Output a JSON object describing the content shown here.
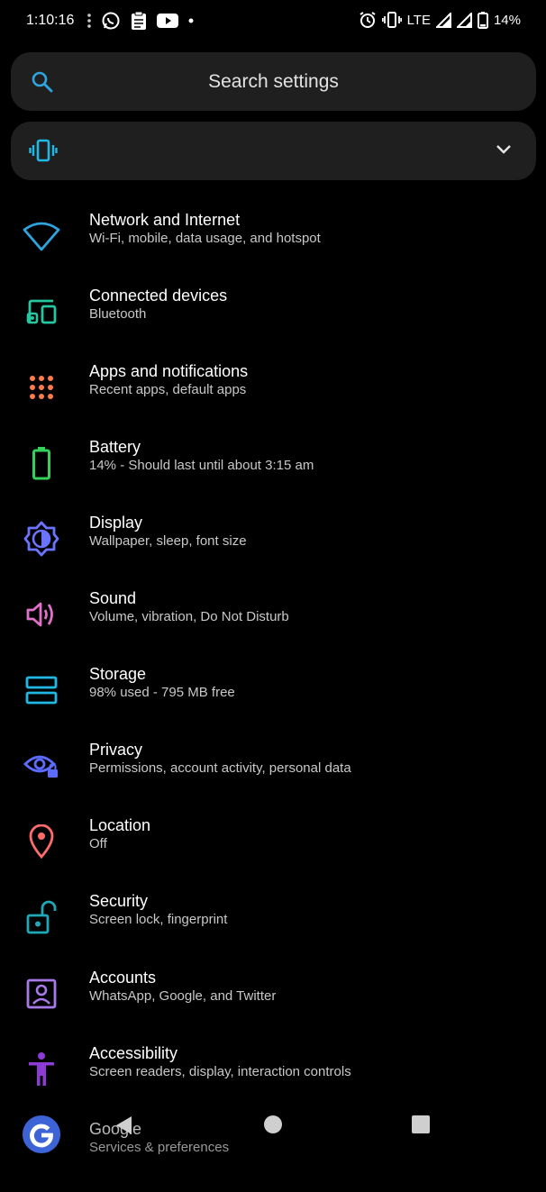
{
  "status_bar": {
    "time": "1:10:16",
    "network": "LTE",
    "battery": "14%"
  },
  "search": {
    "placeholder": "Search settings"
  },
  "colors": {
    "network": "#2fa5e0",
    "connected": "#26c6a0",
    "apps": "#ff7b4a",
    "battery": "#34d15a",
    "display": "#6b74ff",
    "sound": "#e070c8",
    "storage": "#21b8e6",
    "privacy": "#5b6cff",
    "location": "#ff6b6b",
    "security": "#1fa8b8",
    "accounts": "#a879e8",
    "accessibility": "#8e3bd6",
    "google": "#3d64d6"
  },
  "settings": [
    {
      "title": "Network and Internet",
      "subtitle": "Wi-Fi, mobile, data usage, and hotspot",
      "icon": "wifi-icon"
    },
    {
      "title": "Connected devices",
      "subtitle": "Bluetooth",
      "icon": "devices-icon"
    },
    {
      "title": "Apps and notifications",
      "subtitle": "Recent apps, default apps",
      "icon": "apps-grid-icon"
    },
    {
      "title": "Battery",
      "subtitle": "14% - Should last until about 3:15 am",
      "icon": "battery-icon"
    },
    {
      "title": "Display",
      "subtitle": "Wallpaper, sleep, font size",
      "icon": "brightness-icon"
    },
    {
      "title": "Sound",
      "subtitle": "Volume, vibration, Do Not Disturb",
      "icon": "speaker-icon"
    },
    {
      "title": "Storage",
      "subtitle": "98% used - 795 MB free",
      "icon": "storage-icon"
    },
    {
      "title": "Privacy",
      "subtitle": "Permissions, account activity, personal data",
      "icon": "eye-lock-icon"
    },
    {
      "title": "Location",
      "subtitle": "Off",
      "icon": "location-pin-icon"
    },
    {
      "title": "Security",
      "subtitle": "Screen lock, fingerprint",
      "icon": "unlock-icon"
    },
    {
      "title": "Accounts",
      "subtitle": "WhatsApp, Google, and Twitter",
      "icon": "account-box-icon"
    },
    {
      "title": "Accessibility",
      "subtitle": "Screen readers, display, interaction controls",
      "icon": "accessibility-icon"
    },
    {
      "title": "Google",
      "subtitle": "Services & preferences",
      "icon": "google-icon"
    }
  ]
}
